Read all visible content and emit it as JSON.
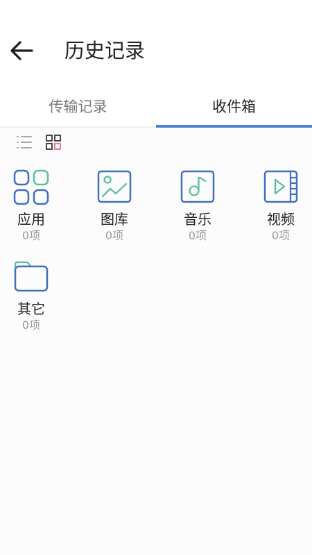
{
  "header": {
    "title": "历史记录",
    "back_icon": "arrow-left-icon"
  },
  "tabs": [
    {
      "label": "传输记录",
      "active": false
    },
    {
      "label": "收件箱",
      "active": true
    }
  ],
  "view_toggle": {
    "list_icon": "list-view-icon",
    "grid_icon": "grid-view-icon",
    "selected": "grid"
  },
  "categories": [
    {
      "label": "应用",
      "count": "0项",
      "icon": "apps-icon"
    },
    {
      "label": "图库",
      "count": "0项",
      "icon": "gallery-icon"
    },
    {
      "label": "音乐",
      "count": "0项",
      "icon": "music-icon"
    },
    {
      "label": "视频",
      "count": "0项",
      "icon": "video-icon"
    },
    {
      "label": "其它",
      "count": "0项",
      "icon": "folder-icon"
    }
  ],
  "colors": {
    "accent": "#4a7fd1",
    "icon_blue": "#3f6fbf",
    "icon_green": "#5bbf9a",
    "grid_toggle_pink": "#e36f7f"
  }
}
